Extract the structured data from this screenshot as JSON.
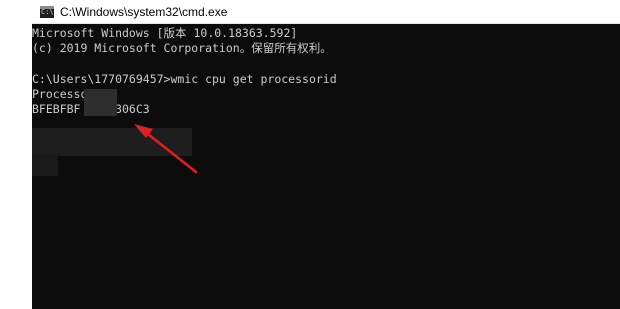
{
  "window": {
    "title": "C:\\Windows\\system32\\cmd.exe",
    "icon": "cmd-icon",
    "icon_glyph": "C:\\"
  },
  "console": {
    "lines": [
      "Microsoft Windows [版本 10.0.18363.592]",
      "(c) 2019 Microsoft Corporation。保留所有权利。",
      "",
      "C:\\Users\\1770769457>wmic cpu get processorid",
      "ProcessorId",
      "BFEBFBF     306C3"
    ]
  },
  "annotation": {
    "arrow_color": "#e02020",
    "arrow_icon": "red-arrow-icon"
  },
  "colors": {
    "console_bg": "#0c0c0c",
    "console_text": "#cccccc",
    "titlebar_bg": "#ffffff"
  }
}
